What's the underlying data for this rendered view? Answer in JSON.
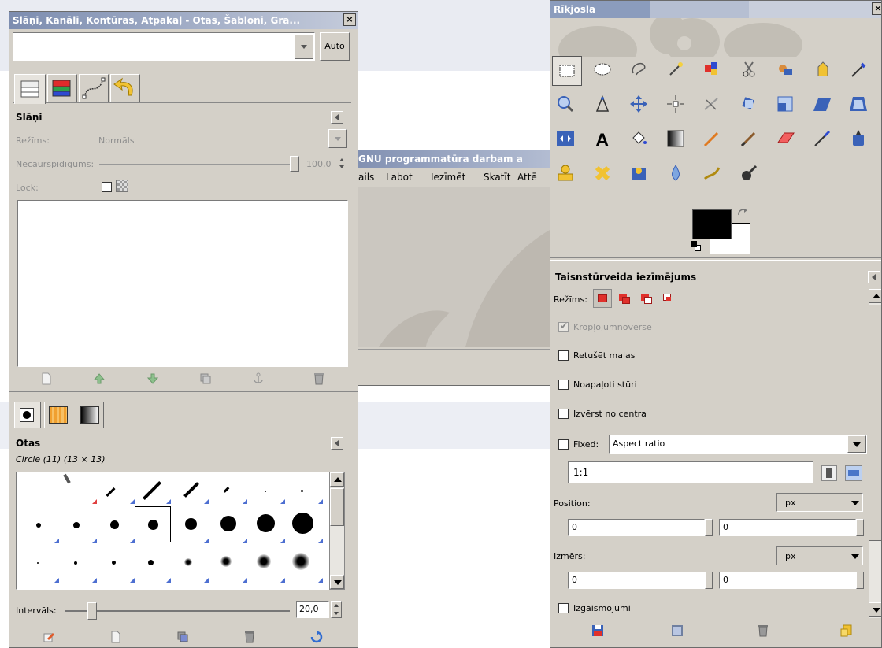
{
  "layers_window": {
    "title": "Slāņi, Kanāli, Kontūras, Atpakaļ - Otas, Šabloni, Gra...",
    "auto_label": "Auto",
    "layers_panel": {
      "title": "Slāņi",
      "mode_label": "Režīms:",
      "mode_value": "Normāls",
      "opacity_label": "Necaurspīdīgums:",
      "opacity_value": "100,0",
      "lock_label": "Lock:"
    },
    "brushes_panel": {
      "title": "Otas",
      "brush_name": "Circle (11) (13 × 13)",
      "spacing_label": "Intervāls:",
      "spacing_value": "20,0"
    }
  },
  "image_window": {
    "title": "GNU programmatūra darbam a",
    "menu": [
      "ails",
      "Labot",
      "Iezīmēt",
      "Skatīt",
      "Attē"
    ]
  },
  "toolbox_window": {
    "title": "Rīkjosla",
    "tools": [
      "rect-select",
      "ellipse-select",
      "free-select",
      "fuzzy-select",
      "color-select",
      "scissors",
      "foreground-select",
      "paths",
      "color-picker",
      "zoom",
      "measure",
      "move",
      "align",
      "crop",
      "rotate",
      "scale",
      "shear",
      "perspective",
      "flip",
      "text",
      "bucket-fill",
      "blend",
      "pencil",
      "paintbrush",
      "eraser",
      "airbrush",
      "ink",
      "clone",
      "heal",
      "perspective-clone",
      "convolve",
      "smudge",
      "dodge-burn"
    ],
    "tool_options": {
      "title": "Taisnstūrveida iezīmējums",
      "mode_label": "Režīms:",
      "antialias_label": "Kropļojumnovērse",
      "feather_label": "Retušēt malas",
      "rounded_label": "Noapaļoti stūri",
      "expand_label": "Izvērst no centra",
      "fixed_label": "Fixed:",
      "fixed_value": "Aspect ratio",
      "ratio_value": "1:1",
      "position_label": "Position:",
      "position_unit": "px",
      "position_x": "0",
      "position_y": "0",
      "size_label": "Izmērs:",
      "size_unit": "px",
      "size_w": "0",
      "size_h": "0",
      "highlight_label": "Izgaismojumi"
    }
  },
  "colors": {
    "titlebar_start": "#8d9ebf",
    "titlebar_end": "#c8cfdd",
    "accent_red": "#e0302b",
    "fg": "#000000",
    "bg": "#ffffff"
  }
}
